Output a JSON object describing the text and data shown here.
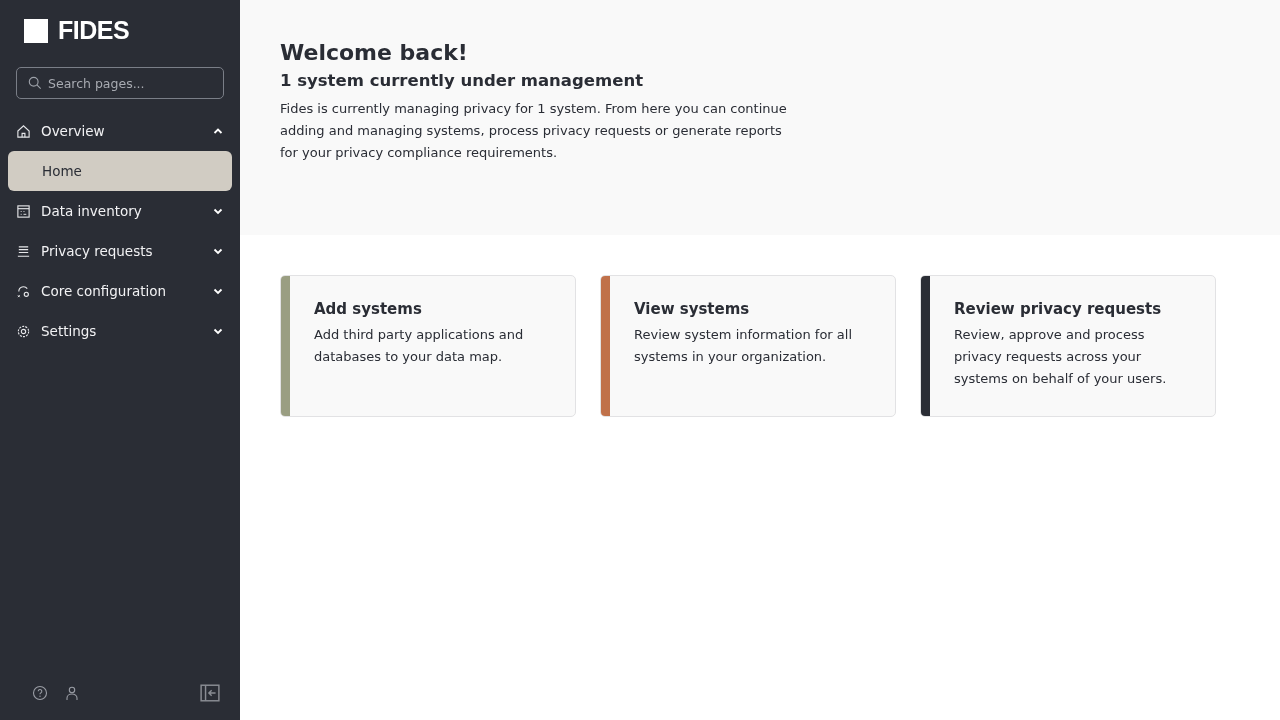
{
  "sidebar": {
    "logo": "FIDES",
    "search": {
      "placeholder": "Search pages..."
    },
    "nav": [
      {
        "label": "Overview",
        "expanded": true,
        "children": [
          {
            "label": "Home",
            "selected": true
          }
        ]
      },
      {
        "label": "Data inventory",
        "expanded": false
      },
      {
        "label": "Privacy requests",
        "expanded": false
      },
      {
        "label": "Core configuration",
        "expanded": false
      },
      {
        "label": "Settings",
        "expanded": false
      }
    ]
  },
  "header": {
    "title": "Welcome back!",
    "subtitle": "1 system currently under management",
    "description": "Fides is currently managing privacy for 1 system. From here you can continue adding and managing systems, process privacy requests or generate reports for your privacy compliance requirements."
  },
  "cards": [
    {
      "title": "Add systems",
      "description": "Add third party applications and databases to your data map.",
      "color": "#9a9e82"
    },
    {
      "title": "View systems",
      "description": "Review system information for all systems in your organization.",
      "color": "#c0714a"
    },
    {
      "title": "Review privacy requests",
      "description": "Review, approve and process privacy requests across your systems on behalf of your users.",
      "color": "#2a2d35"
    }
  ]
}
